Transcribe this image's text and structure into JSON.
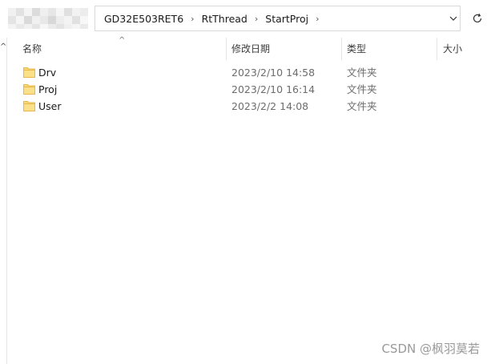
{
  "address": {
    "crumbs": [
      "GD32E503RET6",
      "RtThread",
      "StartProj"
    ],
    "separator": "›",
    "dropdown_icon": "chevron-down-icon",
    "refresh_icon": "refresh-icon"
  },
  "columns": {
    "name": "名称",
    "date": "修改日期",
    "type": "类型",
    "size": "大小"
  },
  "files": [
    {
      "name": "Drv",
      "date": "2023/2/10 14:58",
      "type": "文件夹"
    },
    {
      "name": "Proj",
      "date": "2023/2/10 16:14",
      "type": "文件夹"
    },
    {
      "name": "User",
      "date": "2023/2/2 14:08",
      "type": "文件夹"
    }
  ],
  "watermark": "CSDN @枫羽莫若",
  "colors": {
    "folder": "#f8d775",
    "folder_dark": "#e8b84a"
  }
}
